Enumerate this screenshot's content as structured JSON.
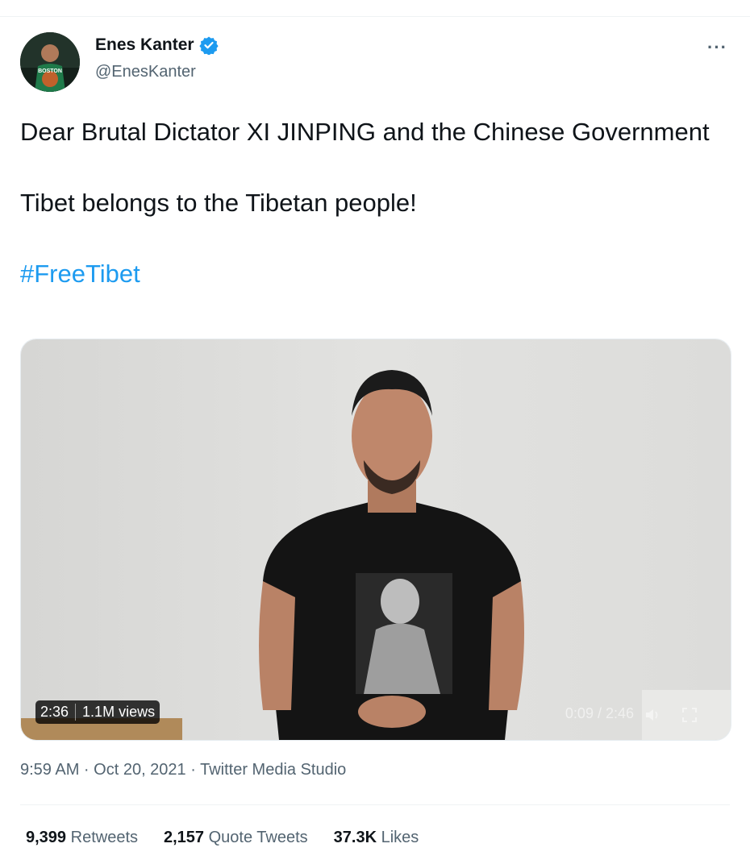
{
  "author": {
    "name": "Enes Kanter",
    "handle": "@EnesKanter",
    "jersey_text": "BOSTON"
  },
  "tweet": {
    "line1": "Dear Brutal Dictator XI JINPING and the Chinese Government",
    "line2": "Tibet belongs to the Tibetan people!",
    "hashtag": "#FreeTibet"
  },
  "video": {
    "duration": "2:36",
    "views": "1.1M views",
    "player_time": "0:09 / 2:46"
  },
  "meta": {
    "timestamp": "9:59 AM · Oct 20, 2021 · Twitter Media Studio"
  },
  "stats": {
    "retweets_count": "9,399",
    "retweets_label": "Retweets",
    "quotes_count": "2,157",
    "quotes_label": "Quote Tweets",
    "likes_count": "37.3K",
    "likes_label": "Likes"
  },
  "colors": {
    "link": "#1d9bf0",
    "verified": "#1d9bf0",
    "secondary_text": "#536471"
  },
  "icons": [
    "verified-badge-icon",
    "more-options-icon",
    "volume-icon",
    "fullscreen-icon"
  ]
}
